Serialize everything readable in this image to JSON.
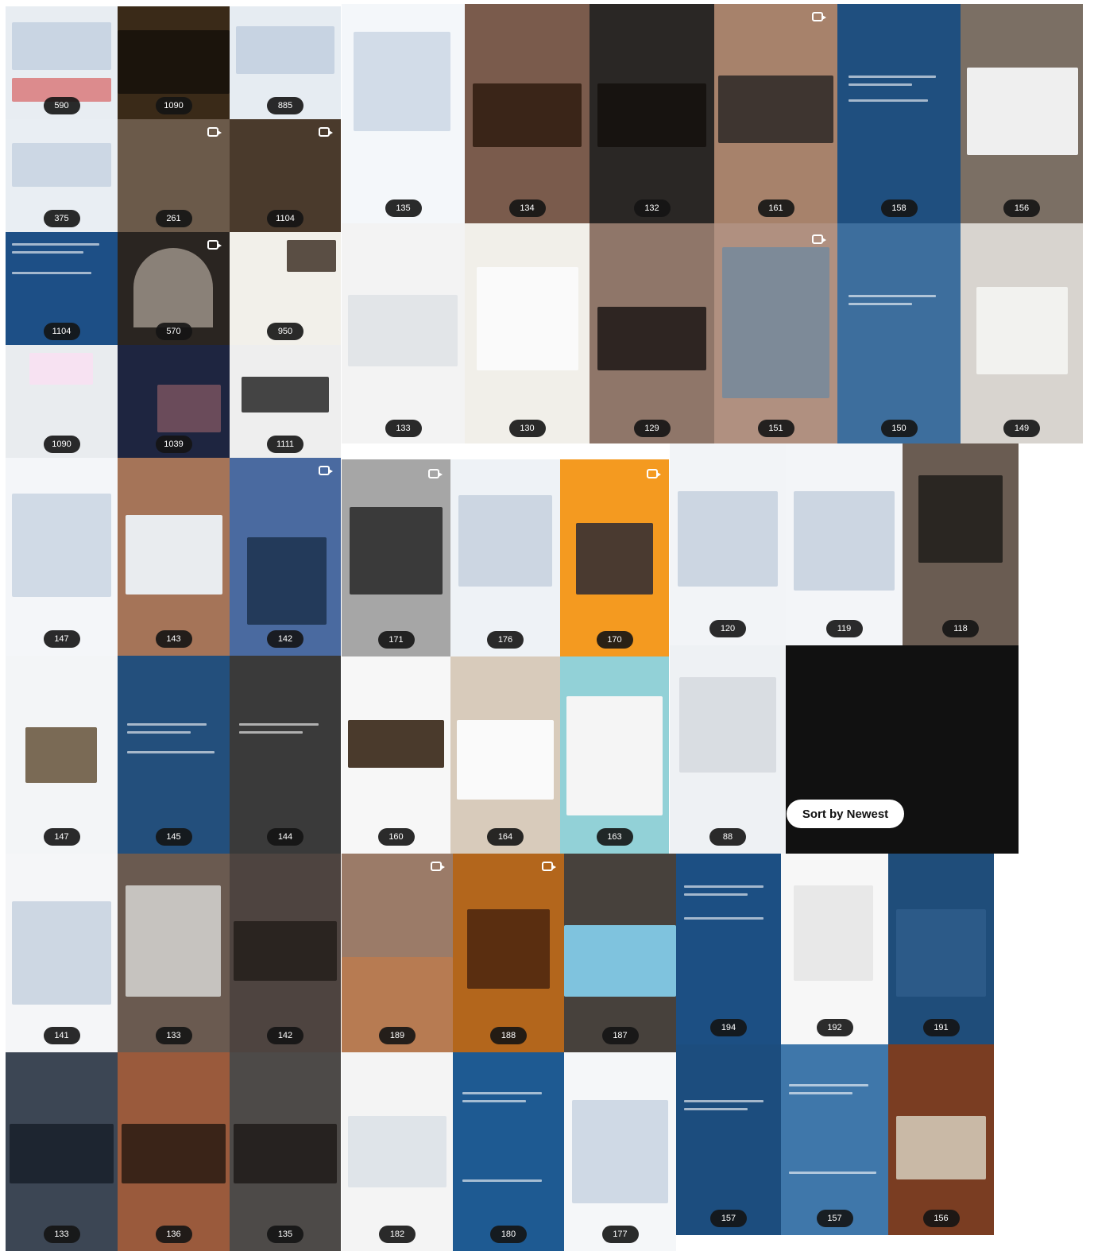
{
  "sort_button": {
    "label": "Sort by Newest"
  },
  "panels": [
    {
      "name": "panel-1",
      "tiles": [
        {
          "badge": "590",
          "bg": "#e8edf2"
        },
        {
          "badge": "1090",
          "bg": "#3a2a18"
        },
        {
          "badge": "885",
          "bg": "#e6ecf2"
        },
        {
          "badge": "375",
          "bg": "#e9eef3"
        },
        {
          "badge": "261",
          "bg": "#6b5a4a"
        },
        {
          "badge": "1104",
          "bg": "#4a3a2c"
        },
        {
          "badge": "1104",
          "bg": "#1d4f86"
        },
        {
          "badge": "570",
          "bg": "#2a2521"
        },
        {
          "badge": "950",
          "bg": "#f2f0ea"
        },
        {
          "badge": "1090",
          "bg": "#e9ecef"
        },
        {
          "badge": "1039",
          "bg": "#1e2540"
        },
        {
          "badge": "1111",
          "bg": "#eeeeee"
        }
      ]
    },
    {
      "name": "panel-2",
      "tiles": [
        {
          "badge": "135",
          "bg": "#f4f7fa"
        },
        {
          "badge": "134",
          "bg": "#7a5b4c"
        },
        {
          "badge": "132",
          "bg": "#2a2725"
        },
        {
          "badge": "161",
          "bg": "#a7826b"
        },
        {
          "badge": "158",
          "bg": "#1f4f7f"
        },
        {
          "badge": "156",
          "bg": "#7b6f64"
        },
        {
          "badge": "133",
          "bg": "#f3f3f3"
        },
        {
          "badge": "130",
          "bg": "#f1efe9"
        },
        {
          "badge": "129",
          "bg": "#8f7669"
        },
        {
          "badge": "151",
          "bg": "#b09080"
        },
        {
          "badge": "150",
          "bg": "#3d6e9d"
        },
        {
          "badge": "149",
          "bg": "#d8d4cf"
        }
      ]
    },
    {
      "name": "panel-3",
      "tiles": [
        {
          "badge": "147",
          "bg": "#f4f6f9"
        },
        {
          "badge": "143",
          "bg": "#a57458"
        },
        {
          "badge": "142",
          "bg": "#4a6aa0"
        },
        {
          "badge": "147",
          "bg": "#f3f5f7"
        },
        {
          "badge": "145",
          "bg": "#234f7c"
        },
        {
          "badge": "144",
          "bg": "#3a3a3a"
        }
      ]
    },
    {
      "name": "panel-4",
      "tiles": [
        {
          "badge": "171",
          "bg": "#a6a6a6"
        },
        {
          "badge": "176",
          "bg": "#eef2f6"
        },
        {
          "badge": "170",
          "bg": "#f49a20"
        },
        {
          "badge": "160",
          "bg": "#f7f7f7"
        },
        {
          "badge": "164",
          "bg": "#d8cbbb"
        },
        {
          "badge": "163",
          "bg": "#92d1d7"
        }
      ]
    },
    {
      "name": "panel-5",
      "tiles": [
        {
          "badge": "120",
          "bg": "#f2f4f7"
        },
        {
          "badge": "119",
          "bg": "#f3f5f8"
        },
        {
          "badge": "118",
          "bg": "#6a5c52"
        },
        {
          "badge": "88",
          "bg": "#eef1f4"
        }
      ]
    },
    {
      "name": "panel-6",
      "tiles": [
        {
          "badge": "141",
          "bg": "#f5f6f8"
        },
        {
          "badge": "133",
          "bg": "#6a5a50"
        },
        {
          "badge": "142",
          "bg": "#4e4440"
        },
        {
          "badge": "133",
          "bg": "#3c4654"
        },
        {
          "badge": "136",
          "bg": "#9a5a3c"
        },
        {
          "badge": "135",
          "bg": "#4d4a48"
        }
      ]
    },
    {
      "name": "panel-7",
      "tiles": [
        {
          "badge": "189",
          "bg": "#9b7b68"
        },
        {
          "badge": "188",
          "bg": "#b3661c"
        },
        {
          "badge": "187",
          "bg": "#47413c"
        },
        {
          "badge": "182",
          "bg": "#f4f4f4"
        },
        {
          "badge": "180",
          "bg": "#1e5a92"
        },
        {
          "badge": "177",
          "bg": "#f5f7f9"
        }
      ]
    },
    {
      "name": "panel-8",
      "tiles": [
        {
          "badge": "194",
          "bg": "#1c4f83"
        },
        {
          "badge": "192",
          "bg": "#f7f7f7"
        },
        {
          "badge": "191",
          "bg": "#1f4d7a"
        },
        {
          "badge": "157",
          "bg": "#1c4d7e"
        },
        {
          "badge": "157",
          "bg": "#3f77aa"
        },
        {
          "badge": "156",
          "bg": "#7a3d22"
        }
      ]
    }
  ]
}
